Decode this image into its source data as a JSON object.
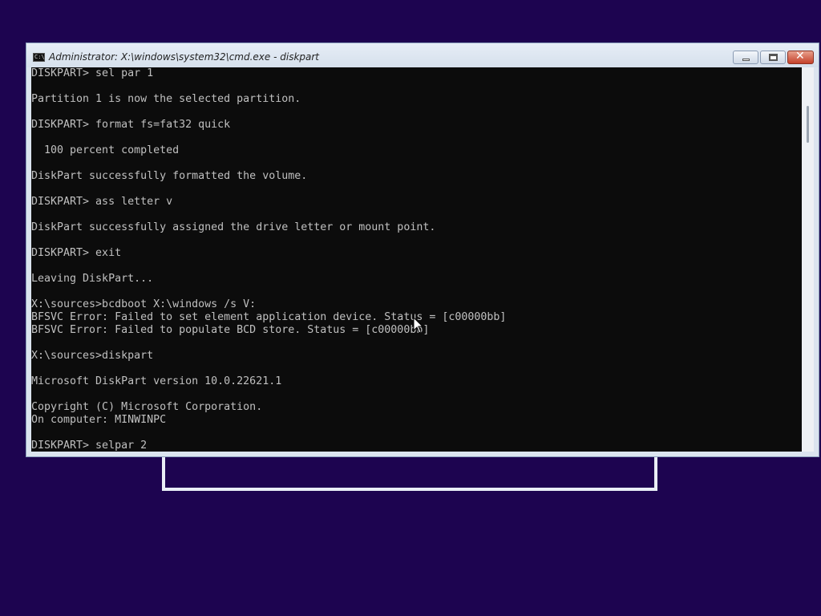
{
  "window": {
    "title": "Administrator: X:\\windows\\system32\\cmd.exe - diskpart",
    "icon": "console-app-icon",
    "icon_glyph": "C:\\"
  },
  "console": {
    "lines": [
      "DISKPART> sel par 1",
      "",
      "Partition 1 is now the selected partition.",
      "",
      "DISKPART> format fs=fat32 quick",
      "",
      "  100 percent completed",
      "",
      "DiskPart successfully formatted the volume.",
      "",
      "DISKPART> ass letter v",
      "",
      "DiskPart successfully assigned the drive letter or mount point.",
      "",
      "DISKPART> exit",
      "",
      "Leaving DiskPart...",
      "",
      "X:\\sources>bcdboot X:\\windows /s V:",
      "BFSVC Error: Failed to set element application device. Status = [c00000bb]",
      "BFSVC Error: Failed to populate BCD store. Status = [c00000bb]",
      "",
      "X:\\sources>diskpart",
      "",
      "Microsoft DiskPart version 10.0.22621.1",
      "",
      "Copyright (C) Microsoft Corporation.",
      "On computer: MINWINPC",
      "",
      "DISKPART> selpar 2"
    ]
  },
  "colors": {
    "desktop": "#1d0450",
    "console_bg": "#0c0c0c",
    "console_fg": "#c0c0c0"
  }
}
